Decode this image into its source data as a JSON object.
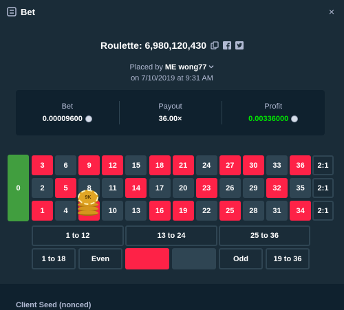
{
  "header": {
    "title": "Bet",
    "close": "×"
  },
  "game": {
    "title": "Roulette: 6,980,120,430"
  },
  "placed": {
    "prefix": "Placed by",
    "user": "ME wong77",
    "date": "on 7/10/2019 at 9:31 AM"
  },
  "stats": {
    "bet_label": "Bet",
    "bet_value": "0.00009600",
    "payout_label": "Payout",
    "payout_value": "36.00×",
    "profit_label": "Profit",
    "profit_value": "0.00336000"
  },
  "board": {
    "zero": "0",
    "row_top": [
      "3",
      "6",
      "9",
      "12",
      "15",
      "18",
      "21",
      "24",
      "27",
      "30",
      "33",
      "36"
    ],
    "row_mid": [
      "2",
      "5",
      "8",
      "11",
      "14",
      "17",
      "20",
      "23",
      "26",
      "29",
      "32",
      "35"
    ],
    "row_bot": [
      "1",
      "4",
      "7",
      "10",
      "13",
      "16",
      "19",
      "22",
      "25",
      "28",
      "31",
      "34"
    ],
    "column_bet": "2:1",
    "dozens": [
      "1 to 12",
      "13 to 24",
      "25 to 36"
    ],
    "outside": [
      "1 to 18",
      "Even",
      "",
      "",
      "Odd",
      "19 to 36"
    ],
    "chip_label": "9K"
  },
  "colors": {
    "red": "#fe2247",
    "black": "#2f4553",
    "green": "#419e3f",
    "profit": "#00e701"
  },
  "footer": {
    "client_seed_label": "Client Seed (nonced)"
  }
}
